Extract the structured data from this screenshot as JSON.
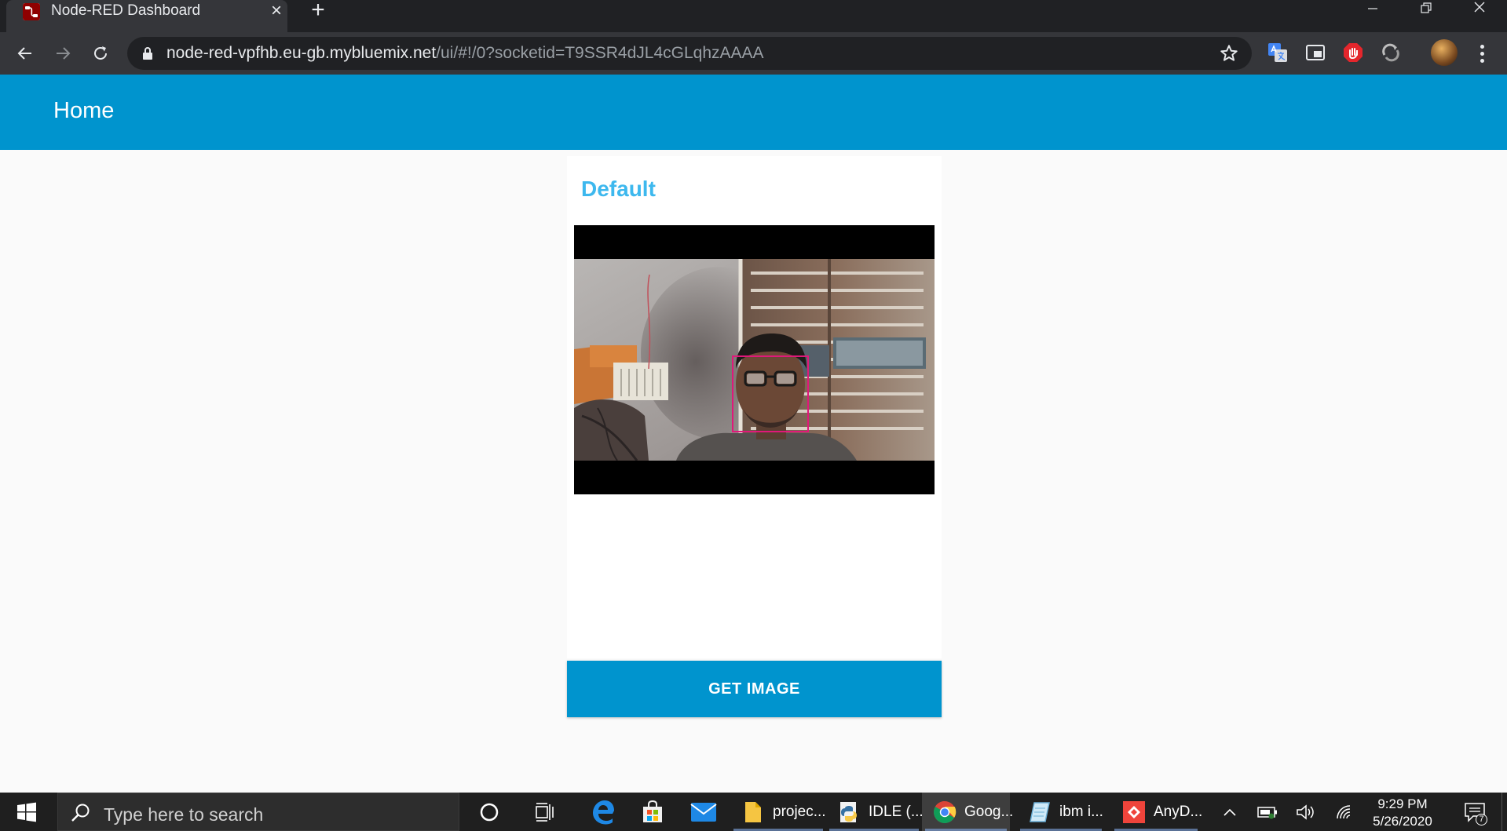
{
  "browser": {
    "tab_title": "Node-RED Dashboard",
    "tab_close": "×",
    "new_tab": "+",
    "url_host": "node-red-vpfhb.eu-gb.mybluemix.net",
    "url_path": "/ui/#!/0?socketid=T9SSR4dJL4cGLqhzAAAA"
  },
  "dashboard": {
    "header_title": "Home",
    "group_title": "Default",
    "button_label": "GET IMAGE",
    "accent": "#0094ce",
    "title_color": "#3db8ee"
  },
  "taskbar": {
    "search_placeholder": "Type here to search",
    "apps": [
      {
        "label": "projec...",
        "icon": "file-explorer-icon"
      },
      {
        "label": "IDLE (...",
        "icon": "python-idle-icon"
      },
      {
        "label": "Goog...",
        "icon": "chrome-icon"
      },
      {
        "label": "ibm i...",
        "icon": "notepad-icon"
      },
      {
        "label": "AnyD...",
        "icon": "anydesk-icon"
      }
    ],
    "clock_time": "9:29 PM",
    "clock_date": "5/26/2020",
    "notification_count": "7"
  }
}
